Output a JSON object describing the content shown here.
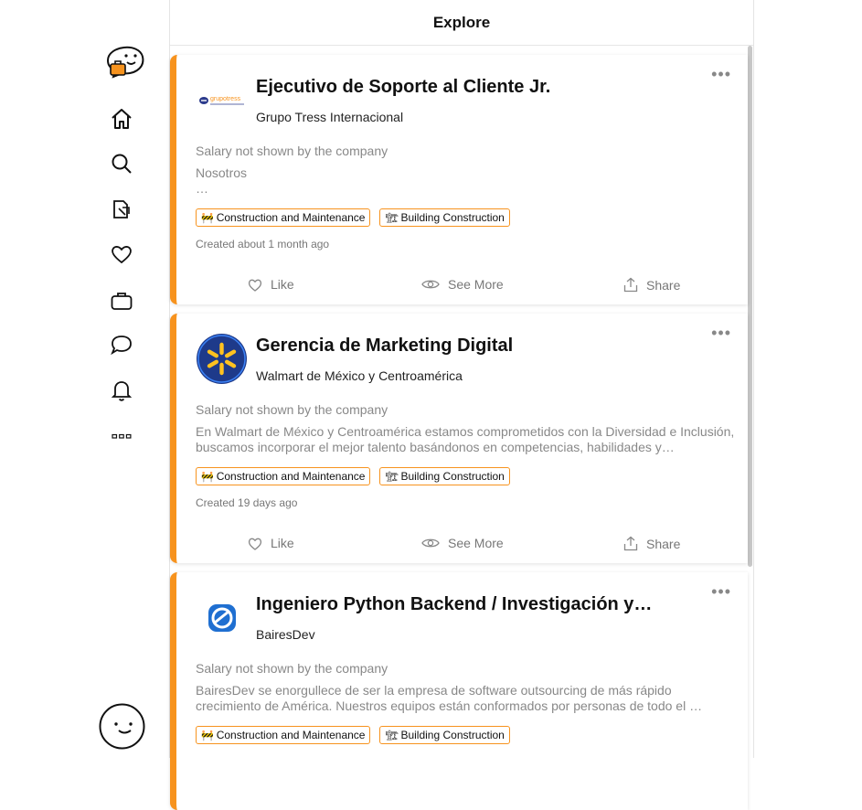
{
  "header": {
    "title": "Explore"
  },
  "sidebar": {
    "items": [
      {
        "name": "home"
      },
      {
        "name": "search"
      },
      {
        "name": "documents"
      },
      {
        "name": "favorites"
      },
      {
        "name": "jobs"
      },
      {
        "name": "messages"
      },
      {
        "name": "notifications"
      },
      {
        "name": "more"
      }
    ]
  },
  "colors": {
    "accent": "#f7931e"
  },
  "actions": {
    "like": "Like",
    "see_more": "See More",
    "share": "Share"
  },
  "jobs": [
    {
      "title": "Ejecutivo de Soporte al Cliente Jr.",
      "company": "Grupo Tress Internacional",
      "logo_text": "grupotress",
      "salary": "Salary not shown by the company",
      "description": "Nosotros\n…",
      "tags": [
        "Construction and Maintenance",
        "Building Construction"
      ],
      "created": "Created about 1 month ago"
    },
    {
      "title": "Gerencia de Marketing Digital",
      "company": "Walmart de México y Centroamérica",
      "salary": "Salary not shown by the company",
      "description": "En Walmart de México y Centroamérica estamos comprometidos con la Diversidad e Inclusión, buscamos incorporar el mejor talento basándonos en competencias, habilidades y…",
      "tags": [
        "Construction and Maintenance",
        "Building Construction"
      ],
      "created": "Created 19 days ago"
    },
    {
      "title": "Ingeniero Python Backend / Investigación y…",
      "company": "BairesDev",
      "salary": "Salary not shown by the company",
      "description": "BairesDev se enorgullece de ser la empresa de software outsourcing de más rápido crecimiento de América. Nuestros equipos están conformados por personas de todo el …",
      "tags": [
        "Construction and Maintenance",
        "Building Construction"
      ],
      "created": ""
    }
  ]
}
